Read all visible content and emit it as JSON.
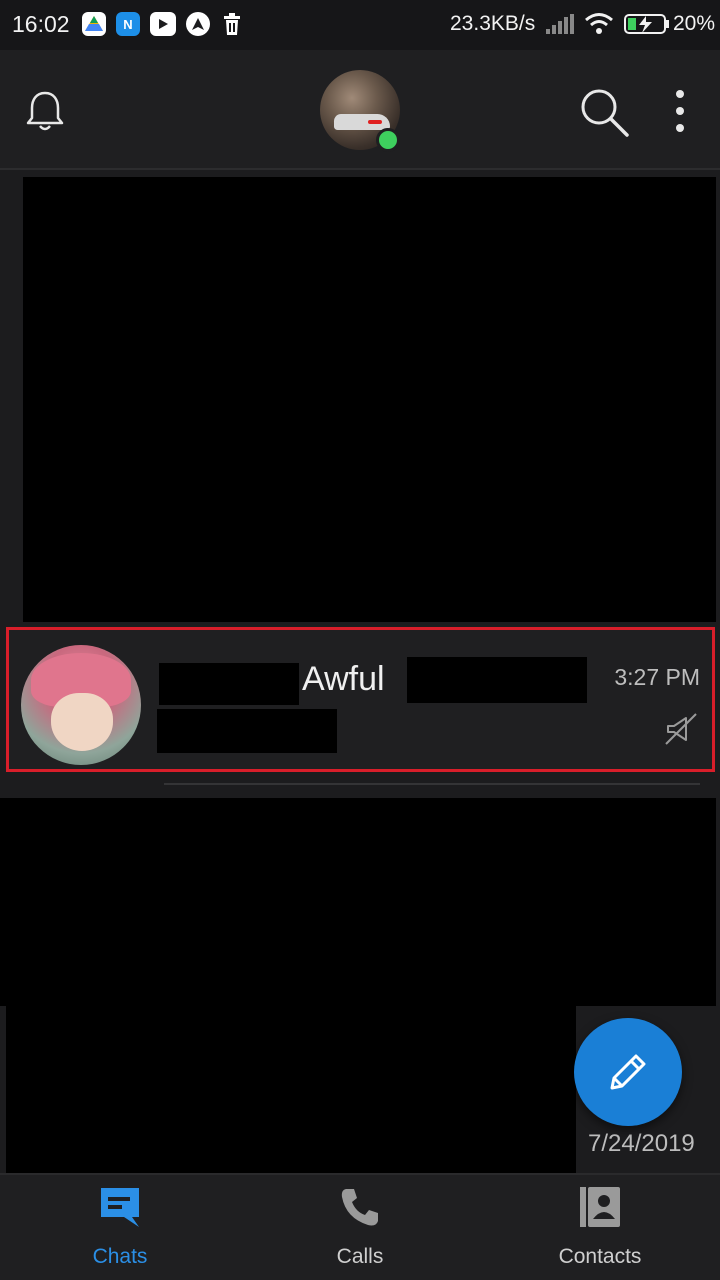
{
  "status_bar": {
    "time": "16:02",
    "network_speed": "23.3KB/s",
    "battery_percent": "20%",
    "notification_icons": [
      "drive-icon",
      "n-app-icon",
      "youtube-icon",
      "maps-icon",
      "trash-icon"
    ]
  },
  "header": {
    "icons": {
      "left": "bell-icon",
      "right": [
        "search-icon",
        "more-vert-icon"
      ]
    },
    "profile_status": "online"
  },
  "chat_row": {
    "name_visible": "Awful",
    "time": "3:27 PM",
    "muted": true
  },
  "list_footer": {
    "date": "7/24/2019"
  },
  "bottom_nav": {
    "tabs": [
      {
        "label": "Chats",
        "icon": "chat-icon",
        "active": true
      },
      {
        "label": "Calls",
        "icon": "phone-icon",
        "active": false
      },
      {
        "label": "Contacts",
        "icon": "contacts-icon",
        "active": false
      }
    ]
  },
  "colors": {
    "accent": "#2b8fe6",
    "fab": "#1a7fd6",
    "online": "#3ecf5e",
    "highlight_border": "#d81e2a",
    "background": "#1c1c1e"
  }
}
